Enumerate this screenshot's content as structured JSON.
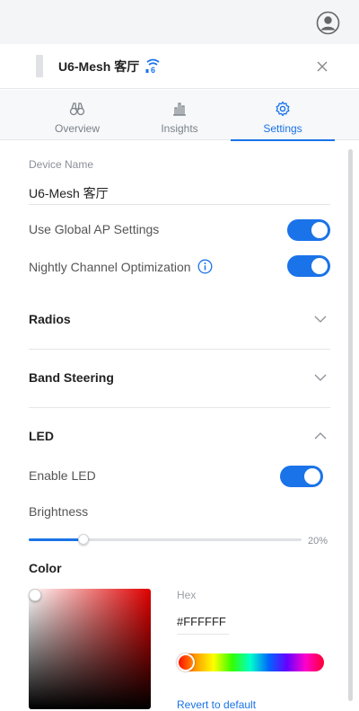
{
  "header": {
    "device_title": "U6-Mesh 客厅",
    "close_icon": "close-icon",
    "avatar_icon": "user-avatar-icon",
    "badge_icon": "wifi6-badge-icon"
  },
  "tabs": [
    {
      "label": "Overview",
      "icon": "binoculars-icon",
      "active": false
    },
    {
      "label": "Insights",
      "icon": "bar-chart-icon",
      "active": false
    },
    {
      "label": "Settings",
      "icon": "gear-icon",
      "active": true
    }
  ],
  "settings": {
    "device_name_label": "Device Name",
    "device_name_value": "U6-Mesh 客厅",
    "use_global_ap_label": "Use Global AP Settings",
    "use_global_ap_on": true,
    "nightly_channel_label": "Nightly Channel Optimization",
    "nightly_channel_on": true
  },
  "sections": {
    "radios": "Radios",
    "band_steering": "Band Steering",
    "led": "LED"
  },
  "led": {
    "enable_label": "Enable LED",
    "enable_on": true,
    "brightness_label": "Brightness",
    "brightness_value": 20,
    "brightness_text": "20%",
    "color_title": "Color",
    "hex_label": "Hex",
    "hex_value": "#FFFFFF",
    "revert_label": "Revert to default"
  },
  "colors": {
    "accent": "#1a73e8"
  }
}
